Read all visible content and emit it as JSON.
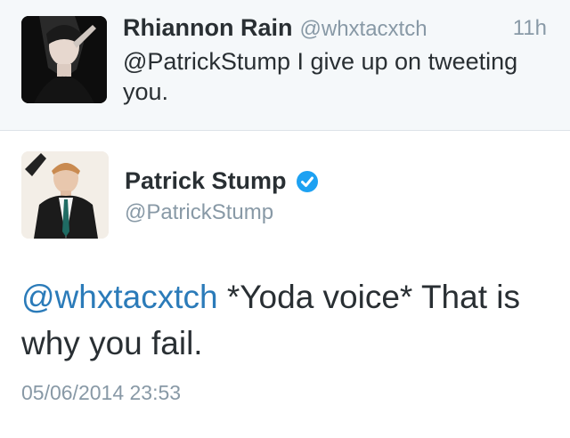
{
  "reply_tweet": {
    "name": "Rhiannon Rain",
    "handle": "@whxtacxtch",
    "time": "11h",
    "text": "@PatrickStump I give up on tweeting you."
  },
  "main_tweet": {
    "name": "Patrick Stump",
    "verified_icon": "verified-badge-icon",
    "handle": "@PatrickStump",
    "mention": "@whxtacxtch",
    "text": "*Yoda voice* That is why you fail.",
    "timestamp": "05/06/2014 23:53"
  },
  "colors": {
    "accent": "#2b7bb9",
    "verified": "#1da1f2",
    "muted": "#8899a6",
    "text": "#292f33",
    "reply_background": "#f5f8fa"
  }
}
